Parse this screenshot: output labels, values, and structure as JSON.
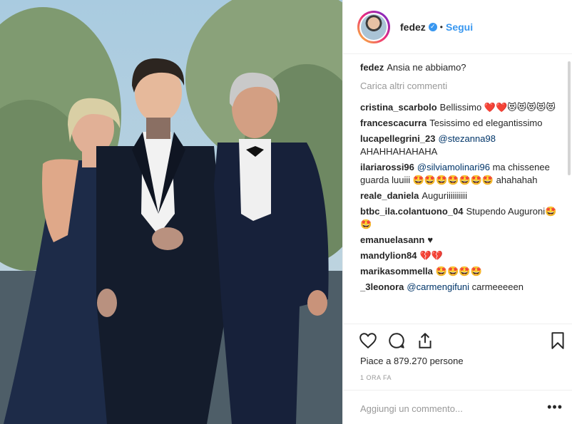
{
  "post": {
    "username": "fedez",
    "dot": "•",
    "follow_label": "Segui",
    "caption_user": "fedez",
    "caption_text": "Ansia ne abbiamo?",
    "load_more": "Carica altri commenti",
    "likes_text": "Piace a 879.270 persone",
    "time_ago": "1 ORA FA",
    "add_comment_placeholder": "Aggiungi un commento...",
    "more_options": "•••",
    "verified_mark": "✓"
  },
  "comments": [
    {
      "user": "cristina_scarbolo",
      "text": "Bellissimo ❤️❤️😻😻😻😻😻"
    },
    {
      "user": "francescacurra",
      "text": "Tesissimo ed elegantissimo"
    },
    {
      "user": "lucapellegrini_23",
      "mention": "@stezanna98",
      "text": "AHAHHAHAHAHA"
    },
    {
      "user": "ilariarossi96",
      "mention": "@silviamolinari96",
      "text": "ma chissenee guarda luuiii 🤩🤩🤩🤩🤩🤩🤩 ahahahah"
    },
    {
      "user": "reale_daniela",
      "text": "Auguriiiiiiiiii"
    },
    {
      "user": "btbc_ila.colantuono_04",
      "text": "Stupendo Auguroni🤩🤩"
    },
    {
      "user": "emanuelasann",
      "text": "♥"
    },
    {
      "user": "mandylion84",
      "text": "💔💔"
    },
    {
      "user": "marikasommella",
      "text": "🤩🤩🤩🤩"
    },
    {
      "user": "_3leonora",
      "mention": "@carmengifuni",
      "text": "carmeeeeen"
    }
  ],
  "icons": {
    "like": "heart-icon",
    "comment": "comment-icon",
    "share": "share-icon",
    "save": "bookmark-icon"
  },
  "colors": {
    "accent": "#3897f0",
    "text": "#262626",
    "muted": "#999999"
  }
}
